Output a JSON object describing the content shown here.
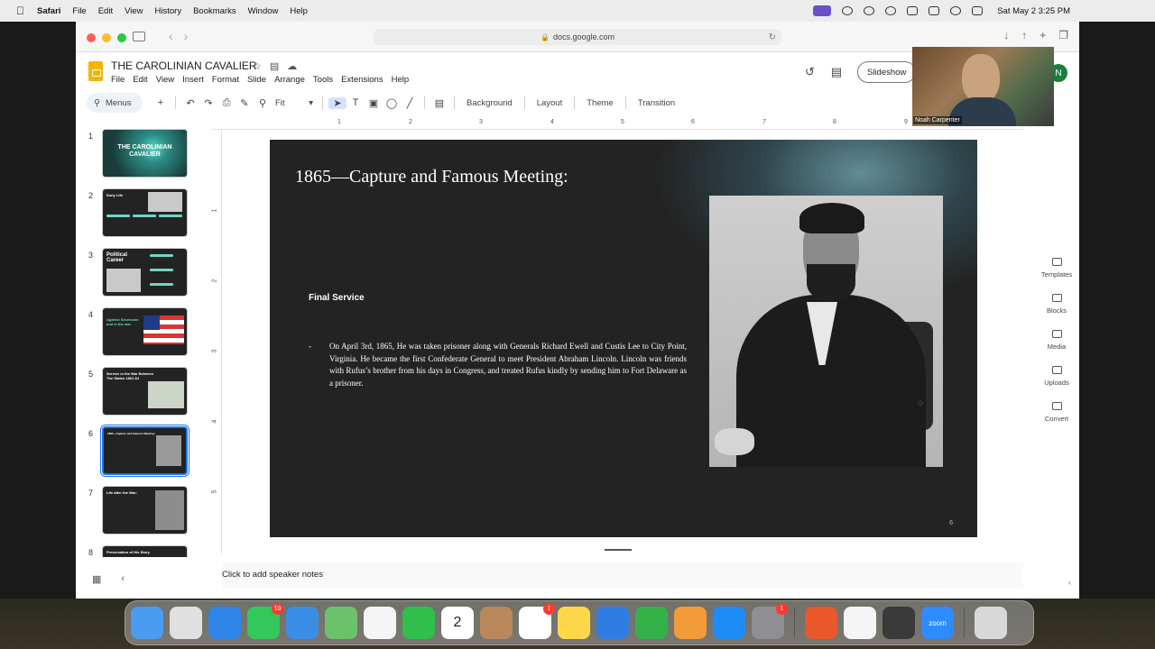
{
  "menubar": {
    "app": "Safari",
    "items": [
      "File",
      "Edit",
      "View",
      "History",
      "Bookmarks",
      "Window",
      "Help"
    ],
    "clock": "Sat May 2  3:25 PM"
  },
  "safari": {
    "url": "docs.google.com"
  },
  "docs": {
    "title": "THE CAROLINIAN CAVALIER",
    "menu": [
      "File",
      "Edit",
      "View",
      "Insert",
      "Format",
      "Slide",
      "Arrange",
      "Tools",
      "Extensions",
      "Help"
    ],
    "slideshow_label": "Slideshow",
    "avatar_initial": "N"
  },
  "toolbar": {
    "menus_label": "Menus",
    "zoom_label": "Fit",
    "background_label": "Background",
    "layout_label": "Layout",
    "theme_label": "Theme",
    "transition_label": "Transition"
  },
  "filmstrip": {
    "slides": [
      {
        "num": "1",
        "text": "THE CAROLINIAN CAVALIER"
      },
      {
        "num": "2",
        "text": "Early Life"
      },
      {
        "num": "3",
        "text": "Political Career"
      },
      {
        "num": "4",
        "text": "Against Secession and in the war."
      },
      {
        "num": "5",
        "text": "Service in the War Between The States 1861-64"
      },
      {
        "num": "6",
        "text": "1865—Capture and Famous Meeting:"
      },
      {
        "num": "7",
        "text": "Life after the War:"
      },
      {
        "num": "8",
        "text": "Preservation of His Story"
      }
    ]
  },
  "ruler": {
    "top": [
      "1",
      "2",
      "3",
      "4",
      "5",
      "6",
      "7",
      "8",
      "9"
    ],
    "left": [
      "1",
      "2",
      "3",
      "4",
      "5"
    ]
  },
  "slide": {
    "title": "1865—Capture and Famous Meeting:",
    "subtitle": "Final Service",
    "bullet": "-",
    "body": "On April 3rd, 1865, He was taken prisoner along with Generals Richard Ewell and Custis Lee to City Point, Virginia. He became the first Confederate General to meet President Abraham Lincoln. Lincoln was friends with Rufus’s brother from his days in Congress, and treated Rufus kindly by sending him to Fort Delaware as a prisoner.",
    "page_number": "6"
  },
  "speaker_notes": "Click to add speaker notes",
  "side_panel": [
    "Templates",
    "Blocks",
    "Media",
    "Uploads",
    "Convert"
  ],
  "webcam": {
    "name": "Noah Carpenter"
  },
  "dock": {
    "apps": [
      {
        "name": "finder",
        "color": "#4a9cf0",
        "label": ""
      },
      {
        "name": "launchpad",
        "color": "#e0e0e0",
        "label": ""
      },
      {
        "name": "safari",
        "color": "#2f86e8",
        "label": ""
      },
      {
        "name": "messages",
        "color": "#34c759",
        "label": "",
        "badge": "10"
      },
      {
        "name": "mail",
        "color": "#3a8ee6",
        "label": ""
      },
      {
        "name": "maps",
        "color": "#6cc26a",
        "label": ""
      },
      {
        "name": "photos",
        "color": "#f5f5f5",
        "label": ""
      },
      {
        "name": "facetime",
        "color": "#2fbf4a",
        "label": ""
      },
      {
        "name": "calendar",
        "color": "#ffffff",
        "label": "2"
      },
      {
        "name": "contacts",
        "color": "#b8875a",
        "label": ""
      },
      {
        "name": "reminders",
        "color": "#ffffff",
        "label": "",
        "badge": "1"
      },
      {
        "name": "notes",
        "color": "#ffd84a",
        "label": ""
      },
      {
        "name": "keynote",
        "color": "#2f7de1",
        "label": ""
      },
      {
        "name": "numbers",
        "color": "#34b24a",
        "label": ""
      },
      {
        "name": "pages",
        "color": "#f29b38",
        "label": ""
      },
      {
        "name": "app-store",
        "color": "#1f8cf5",
        "label": ""
      },
      {
        "name": "system-settings",
        "color": "#8e8e93",
        "label": "",
        "badge": "1"
      },
      {
        "name": "firefox",
        "color": "#e8582c",
        "label": ""
      },
      {
        "name": "news",
        "color": "#f5f5f5",
        "label": ""
      },
      {
        "name": "calculator",
        "color": "#3a3a3a",
        "label": ""
      },
      {
        "name": "zoom",
        "color": "#2d8cff",
        "label": "zoom"
      },
      {
        "name": "trash",
        "color": "#d8d8d8",
        "label": ""
      }
    ]
  }
}
